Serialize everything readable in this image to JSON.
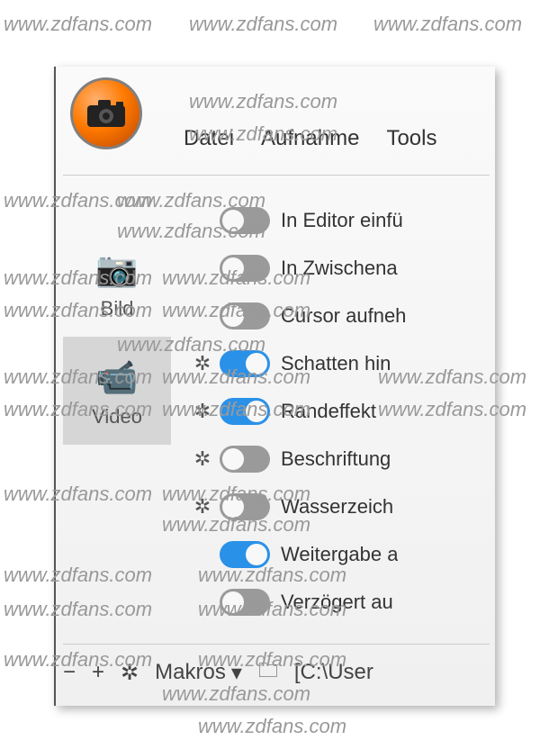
{
  "watermark": "www.zdfans.com",
  "menu": {
    "file": "Datei",
    "capture": "Aufnahme",
    "tools": "Tools"
  },
  "sidebar": {
    "bild": "Bild",
    "video": "Video"
  },
  "options": [
    {
      "gear": false,
      "on": false,
      "label": "In Editor einfü"
    },
    {
      "gear": false,
      "on": false,
      "label": "In Zwischena"
    },
    {
      "gear": false,
      "on": false,
      "label": "Cursor aufneh"
    },
    {
      "gear": true,
      "on": true,
      "label": "Schatten hin"
    },
    {
      "gear": true,
      "on": true,
      "label": "Randeffekt"
    },
    {
      "gear": true,
      "on": false,
      "label": "Beschriftung"
    },
    {
      "gear": true,
      "on": false,
      "label": "Wasserzeich"
    },
    {
      "gear": false,
      "on": true,
      "label": "Weitergabe a"
    },
    {
      "gear": false,
      "on": false,
      "label": "Verzögert au"
    }
  ],
  "bottom": {
    "makros": "Makros",
    "path": "[C:\\User"
  }
}
